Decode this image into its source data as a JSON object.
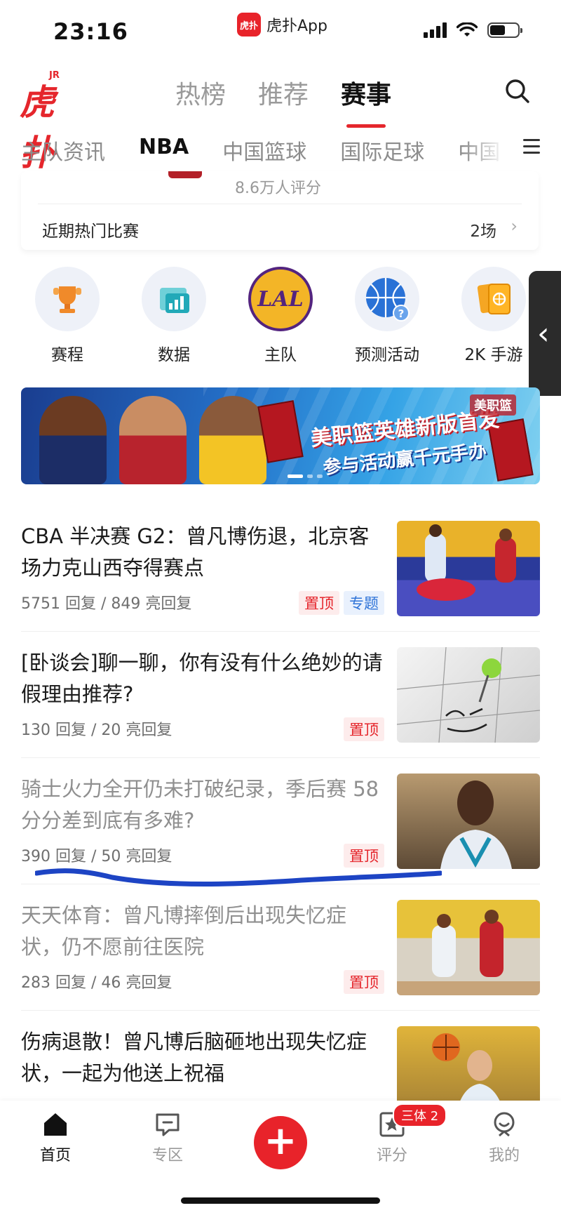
{
  "status_bar": {
    "time": "23:16",
    "app_name": "虎扑App",
    "app_logo_text": "虎扑",
    "battery_level": 0.55
  },
  "header": {
    "logo_text": "虎扑",
    "logo_badge": "JR",
    "tabs": [
      {
        "label": "热榜",
        "active": false
      },
      {
        "label": "推荐",
        "active": false
      },
      {
        "label": "赛事",
        "active": true
      }
    ],
    "search_icon": "search-icon"
  },
  "sub_nav": {
    "tabs": [
      {
        "label": "主队资讯",
        "active": false
      },
      {
        "label": "NBA",
        "active": true
      },
      {
        "label": "中国篮球",
        "active": false
      },
      {
        "label": "国际足球",
        "active": false
      },
      {
        "label": "中国",
        "active": false
      }
    ],
    "menu_icon": "hamburger-menu-icon"
  },
  "team_card": {
    "rating_text": "8.6万人评分",
    "hot_games_label": "近期热门比赛",
    "hot_games_count": "2场"
  },
  "quick_entries": [
    {
      "label": "赛程",
      "icon": "trophy-icon"
    },
    {
      "label": "数据",
      "icon": "chart-icon"
    },
    {
      "label": "主队",
      "icon": "lakers-logo-icon",
      "logo_text": "LAL"
    },
    {
      "label": "预测活动",
      "icon": "basketball-question-icon"
    },
    {
      "label": "2K 手游",
      "icon": "cards-icon"
    }
  ],
  "banner": {
    "title": "美职篮英雄新版首发",
    "subtitle": "参与活动赢千元手办",
    "brand": "美职篮"
  },
  "news": [
    {
      "title": "CBA 半决赛 G2：曾凡博伤退，北京客场力克山西夺得赛点",
      "meta": "5751 回复 / 849 亮回复",
      "tags": [
        "置顶",
        "专题"
      ],
      "read": false
    },
    {
      "title": "[卧谈会]聊一聊，你有没有什么绝妙的请假理由推荐?",
      "meta": "130 回复 / 20 亮回复",
      "tags": [
        "置顶"
      ],
      "read": false
    },
    {
      "title": "骑士火力全开仍未打破纪录，季后赛 58 分分差到底有多难?",
      "meta": "390 回复 / 50 亮回复",
      "tags": [
        "置顶"
      ],
      "read": true
    },
    {
      "title": "天天体育：曾凡博摔倒后出现失忆症状，仍不愿前往医院",
      "meta": "283 回复 / 46 亮回复",
      "tags": [
        "置顶"
      ],
      "read": true
    },
    {
      "title": "伤病退散！曾凡博后脑砸地出现失忆症状，一起为他送上祝福",
      "meta": "",
      "tags": [],
      "read": false
    }
  ],
  "bottom_nav": [
    {
      "label": "首页",
      "icon": "home-icon",
      "active": true
    },
    {
      "label": "专区",
      "icon": "chat-bubble-icon",
      "active": false
    },
    {
      "label": "",
      "icon": "plus-icon",
      "active": false
    },
    {
      "label": "评分",
      "icon": "star-rating-icon",
      "active": false
    },
    {
      "label": "我的",
      "icon": "profile-icon",
      "active": false
    }
  ],
  "badge_text": "三体 2",
  "colors": {
    "brand_red": "#e5262c",
    "topic_blue": "#2f74d8",
    "annotation_stroke": "#1d44c4"
  }
}
